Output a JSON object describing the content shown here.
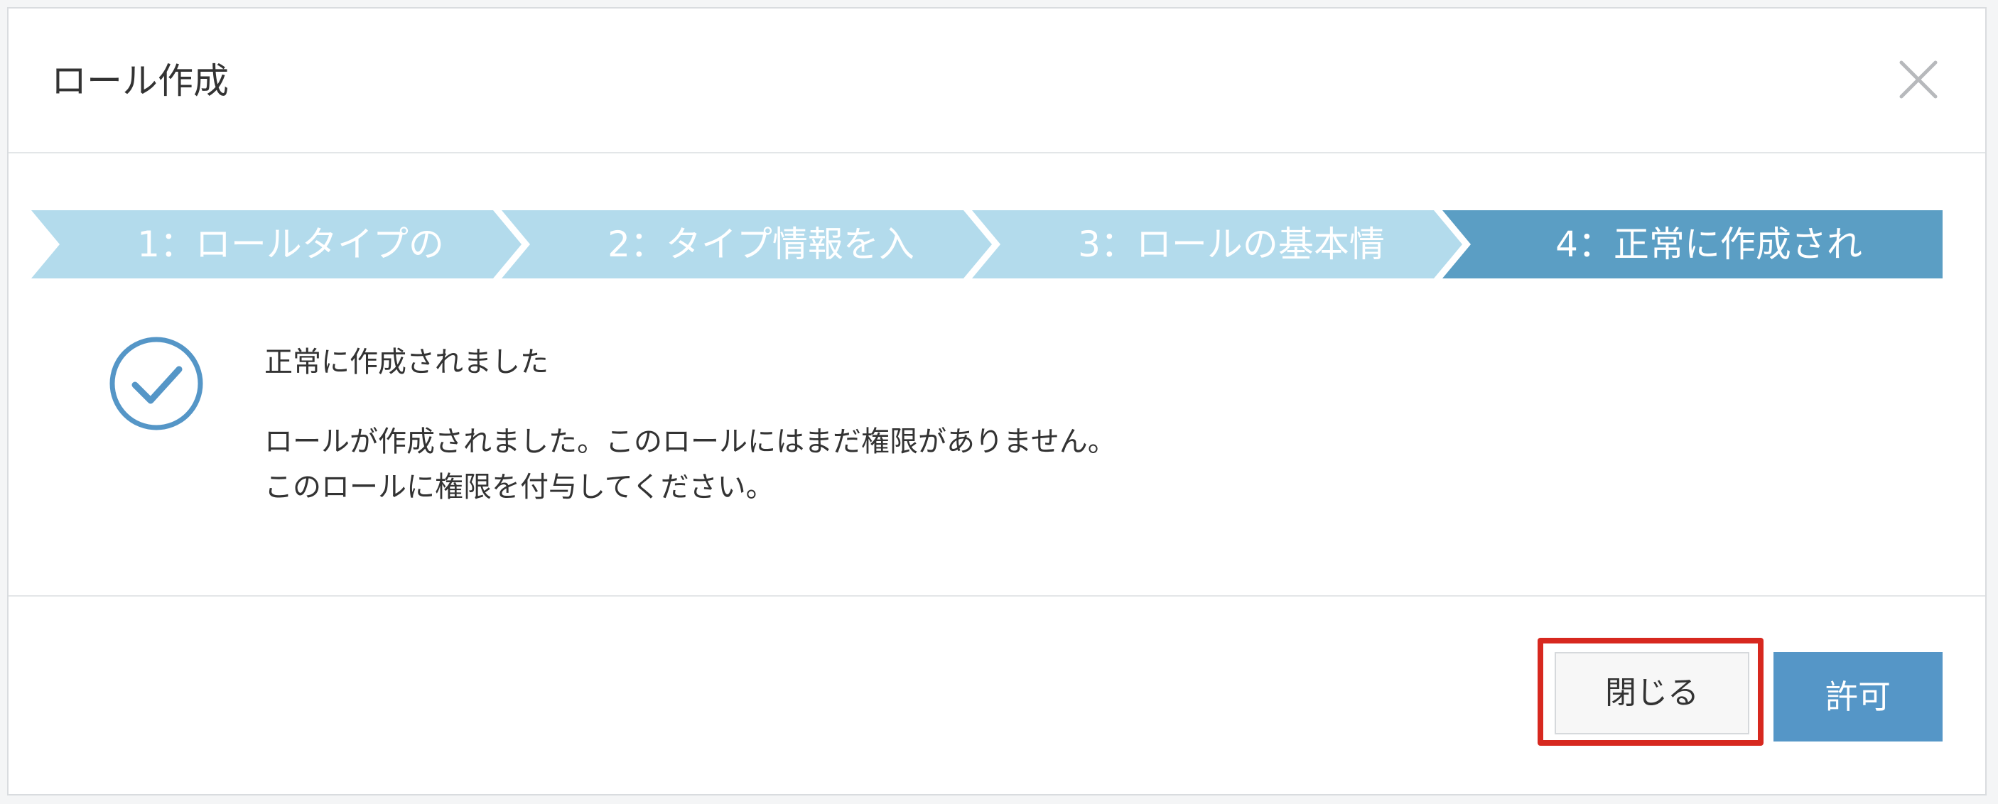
{
  "dialog": {
    "title": "ロール作成"
  },
  "wizard": {
    "steps": [
      {
        "label": "1：ロールタイプの",
        "state": "done"
      },
      {
        "label": "2：タイプ情報を入",
        "state": "done"
      },
      {
        "label": "3：ロールの基本情",
        "state": "done"
      },
      {
        "label": "4：正常に作成され",
        "state": "active"
      }
    ],
    "colors": {
      "inactive": "#b3dbec",
      "active": "#5b9ec4"
    }
  },
  "message": {
    "title": "正常に作成されました",
    "line1": "ロールが作成されました。このロールにはまだ権限がありません。",
    "line2": "このロールに権限を付与してください。"
  },
  "footer": {
    "close_label": "閉じる",
    "allow_label": "許可"
  },
  "colors": {
    "accent": "#5596c7",
    "highlight": "#d7281f"
  }
}
